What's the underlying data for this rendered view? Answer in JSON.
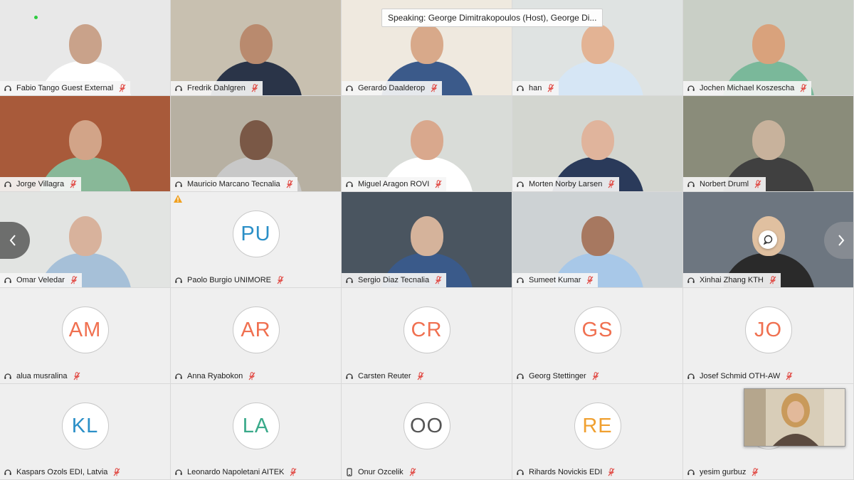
{
  "banner": {
    "speaking_text": "Speaking: George Dimitrakopoulos (Host), George Di..."
  },
  "colors": {
    "avatar_blue": "#2a8fc7",
    "avatar_orange": "#f07050",
    "avatar_gray": "#555555",
    "avatar_yellow": "#f0a030",
    "avatar_green": "#3aaa8a",
    "mute_red": "#e0403a"
  },
  "participants": [
    {
      "name": "Fabio Tango Guest External",
      "type": "video",
      "audio": "headset",
      "muted": true
    },
    {
      "name": "Fredrik Dahlgren",
      "type": "video",
      "audio": "headset",
      "muted": true
    },
    {
      "name": "Gerardo Daalderop",
      "type": "video",
      "audio": "headset",
      "muted": true
    },
    {
      "name": "han",
      "type": "video",
      "audio": "headset",
      "muted": true
    },
    {
      "name": "Jochen Michael Koszescha",
      "type": "video",
      "audio": "headset",
      "muted": true
    },
    {
      "name": "Jorge Villagra",
      "type": "video",
      "audio": "headset",
      "muted": true
    },
    {
      "name": "Mauricio Marcano Tecnalia",
      "type": "video",
      "audio": "headset",
      "muted": true
    },
    {
      "name": "Miguel Aragon ROVI",
      "type": "video",
      "audio": "headset",
      "muted": true
    },
    {
      "name": "Morten Norby Larsen",
      "type": "video",
      "audio": "headset",
      "muted": true
    },
    {
      "name": "Norbert Druml",
      "type": "video",
      "audio": "headset",
      "muted": true
    },
    {
      "name": "Omar Veledar",
      "type": "video",
      "audio": "headset",
      "muted": true
    },
    {
      "name": "Paolo Burgio UNIMORE",
      "type": "avatar",
      "initials": "PU",
      "color": "#2a8fc7",
      "audio": "headset",
      "muted": true
    },
    {
      "name": "Sergio Diaz Tecnalia",
      "type": "video",
      "audio": "headset",
      "muted": true
    },
    {
      "name": "Sumeet Kumar",
      "type": "video",
      "audio": "headset",
      "muted": true
    },
    {
      "name": "Xinhai Zhang KTH",
      "type": "video",
      "audio": "headset",
      "muted": true
    },
    {
      "name": "alua musralina",
      "type": "avatar",
      "initials": "AM",
      "color": "#f07050",
      "audio": "headset",
      "muted": true
    },
    {
      "name": "Anna Ryabokon",
      "type": "avatar",
      "initials": "AR",
      "color": "#f07050",
      "audio": "headset",
      "muted": true
    },
    {
      "name": "Carsten Reuter",
      "type": "avatar",
      "initials": "CR",
      "color": "#f07050",
      "audio": "headset",
      "muted": true
    },
    {
      "name": "Georg Stettinger",
      "type": "avatar",
      "initials": "GS",
      "color": "#f07050",
      "audio": "headset",
      "muted": true
    },
    {
      "name": "Josef Schmid OTH-AW",
      "type": "avatar",
      "initials": "JO",
      "color": "#f07050",
      "audio": "headset",
      "muted": true
    },
    {
      "name": "Kaspars Ozols EDI, Latvia",
      "type": "avatar",
      "initials": "KL",
      "color": "#2a8fc7",
      "audio": "headset",
      "muted": true
    },
    {
      "name": "Leonardo Napoletani AITEK",
      "type": "avatar",
      "initials": "LA",
      "color": "#3aaa8a",
      "audio": "headset",
      "muted": true
    },
    {
      "name": "Onur Ozcelik",
      "type": "avatar",
      "initials": "OO",
      "color": "#555555",
      "audio": "phone",
      "muted": true
    },
    {
      "name": "Rihards Novickis EDI",
      "type": "avatar",
      "initials": "RE",
      "color": "#f0a030",
      "audio": "headset",
      "muted": true
    },
    {
      "name": "yesim gurbuz",
      "type": "avatar",
      "initials": "",
      "color": "#555555",
      "audio": "headset",
      "muted": true
    }
  ],
  "icons": {
    "audio": "headset-icon",
    "phone": "phone-icon",
    "muted": "microphone-muted-icon",
    "prev": "chevron-left-icon",
    "next": "chevron-right-icon",
    "chat": "chat-bubble-icon",
    "warning": "warning-icon"
  }
}
